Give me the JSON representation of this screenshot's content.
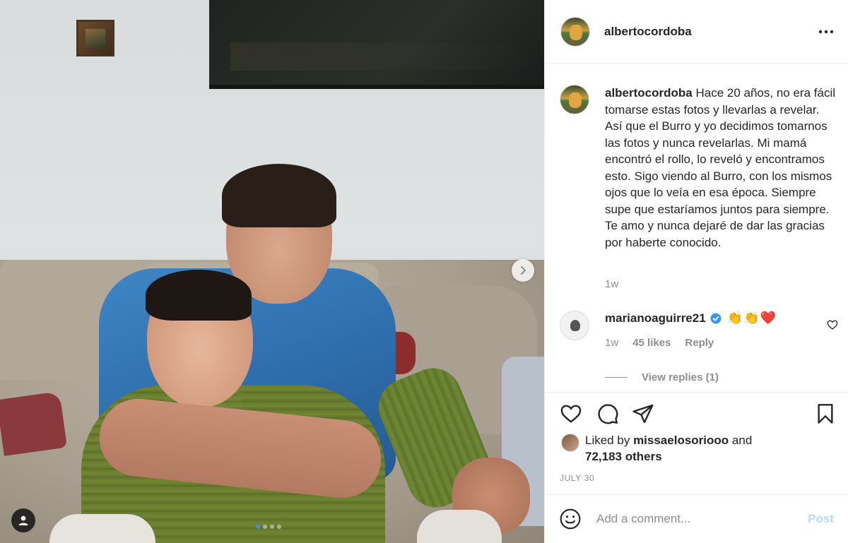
{
  "post": {
    "username": "albertocordoba",
    "more_icon": "more-horizontal-icon",
    "carousel": {
      "dots": 4,
      "active_index": 0
    },
    "photo_description_icon": "user-tag-icon"
  },
  "caption": {
    "username": "albertocordoba",
    "text": "Hace 20 años, no era fácil tomarse estas fotos y llevarlas a revelar. Así que el Burro y yo decidimos tomarnos las fotos y nunca revelarlas. Mi mamá encontró el rollo, lo reveló y encontramos esto. Sigo viendo al Burro, con los mismos ojos que lo veía en esa época. Siempre supe que estaríamos juntos para siempre. Te amo y nunca dejaré de dar las gracias por haberte conocido.",
    "time": "1w"
  },
  "comment": {
    "username": "marianoaguirre21",
    "verified": true,
    "text": "👏👏❤️",
    "time": "1w",
    "likes": "45 likes",
    "reply_label": "Reply",
    "view_replies": "View replies (1)"
  },
  "likes": {
    "prefix": "Liked by",
    "user": "missaelosoriooo",
    "and": "and",
    "others": "72,183 others"
  },
  "date": "JULY 30",
  "add_comment": {
    "placeholder": "Add a comment...",
    "post_label": "Post"
  },
  "colors": {
    "text": "#262626",
    "secondary": "#8e8e8e",
    "border": "#efefef",
    "post_disabled": "#b3dbff",
    "verified": "#3897f0",
    "carousel_active": "#3b8ff0"
  }
}
